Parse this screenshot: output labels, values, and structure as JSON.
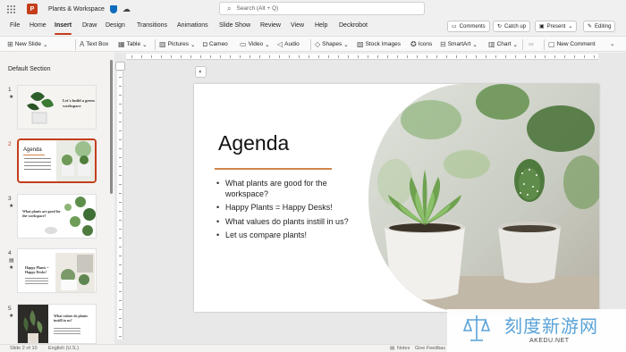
{
  "app": {
    "logo_letter": "P",
    "document_title": "Plants & Workspace",
    "search_placeholder": "Search (Alt + Q)"
  },
  "menu": {
    "tabs": [
      "File",
      "Home",
      "Insert",
      "Draw",
      "Design",
      "Transitions",
      "Animations",
      "Slide Show",
      "Review",
      "View",
      "Help",
      "Deckrobot"
    ],
    "active_tab": "Insert",
    "comments_label": "Comments",
    "catchup_label": "Catch up",
    "present_label": "Present",
    "editing_label": "Editing"
  },
  "ribbon": {
    "new_slide": "New Slide",
    "text_box": "Text Box",
    "table": "Table",
    "pictures": "Pictures",
    "cameo": "Cameo",
    "video": "Video",
    "audio": "Audio",
    "shapes": "Shapes",
    "stock_images": "Stock Images",
    "icons": "Icons",
    "smartart": "SmartArt",
    "chart": "Chart",
    "new_comment": "New Comment"
  },
  "slides_panel": {
    "section": "Default Section",
    "thumbnails": [
      {
        "number": "1",
        "caption": "Let's build a green workspace"
      },
      {
        "number": "2",
        "caption": "Agenda"
      },
      {
        "number": "3",
        "caption": "What plants are good for the workspace?"
      },
      {
        "number": "4",
        "caption": "Happy Plants = Happy Desks!"
      },
      {
        "number": "5",
        "caption": "What values do plants instill in us?"
      }
    ],
    "selected": "2"
  },
  "slide": {
    "title": "Agenda",
    "bullets": [
      "What plants are good for the workspace?",
      "Happy Plants = Happy Desks!",
      "What values do plants instill in us?",
      "Let us compare plants!"
    ],
    "accent_color": "#d2854a"
  },
  "status": {
    "slide_counter": "Slide 2 of 10",
    "language": "English (U.S.)",
    "notes": "Notes",
    "feedback": "Give Feedbac"
  },
  "watermark": {
    "title": "刻度新游网",
    "url": "AKEDU.NET"
  },
  "colors": {
    "brand": "#c43e1c",
    "accent": "#0f6cbd"
  }
}
